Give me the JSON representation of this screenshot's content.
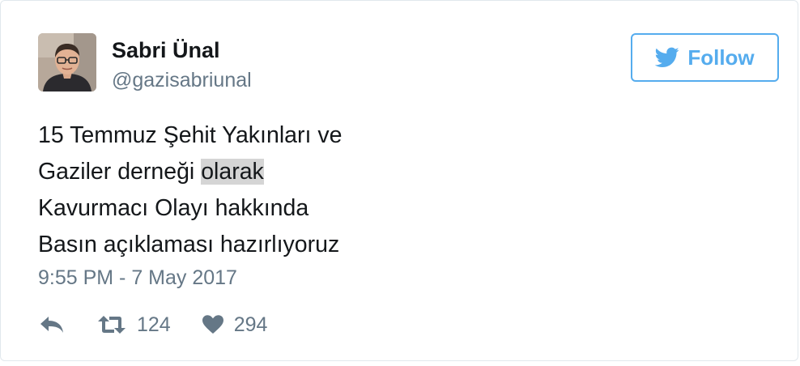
{
  "user": {
    "display_name": "Sabri Ünal",
    "handle": "@gazisabriunal",
    "avatar_icon": "user-avatar-photo"
  },
  "follow_button": {
    "label": "Follow",
    "icon": "twitter-bird-icon",
    "color": "#55acee"
  },
  "tweet": {
    "lines": [
      {
        "text": "15 Temmuz Şehit Yakınları ve"
      },
      {
        "prefix": "Gaziler derneği ",
        "highlighted": "olarak"
      },
      {
        "text": "Kavurmacı Olayı hakkında"
      },
      {
        "text": "Basın açıklaması hazırlıyoruz"
      }
    ],
    "timestamp": "9:55 PM - 7 May 2017"
  },
  "actions": {
    "reply": {
      "icon": "reply-icon"
    },
    "retweet": {
      "icon": "retweet-icon",
      "count": "124"
    },
    "like": {
      "icon": "heart-icon",
      "count": "294"
    }
  },
  "colors": {
    "text": "#14171a",
    "secondary": "#657786",
    "border": "#e1e8ed",
    "highlight": "#d5d5d5"
  }
}
